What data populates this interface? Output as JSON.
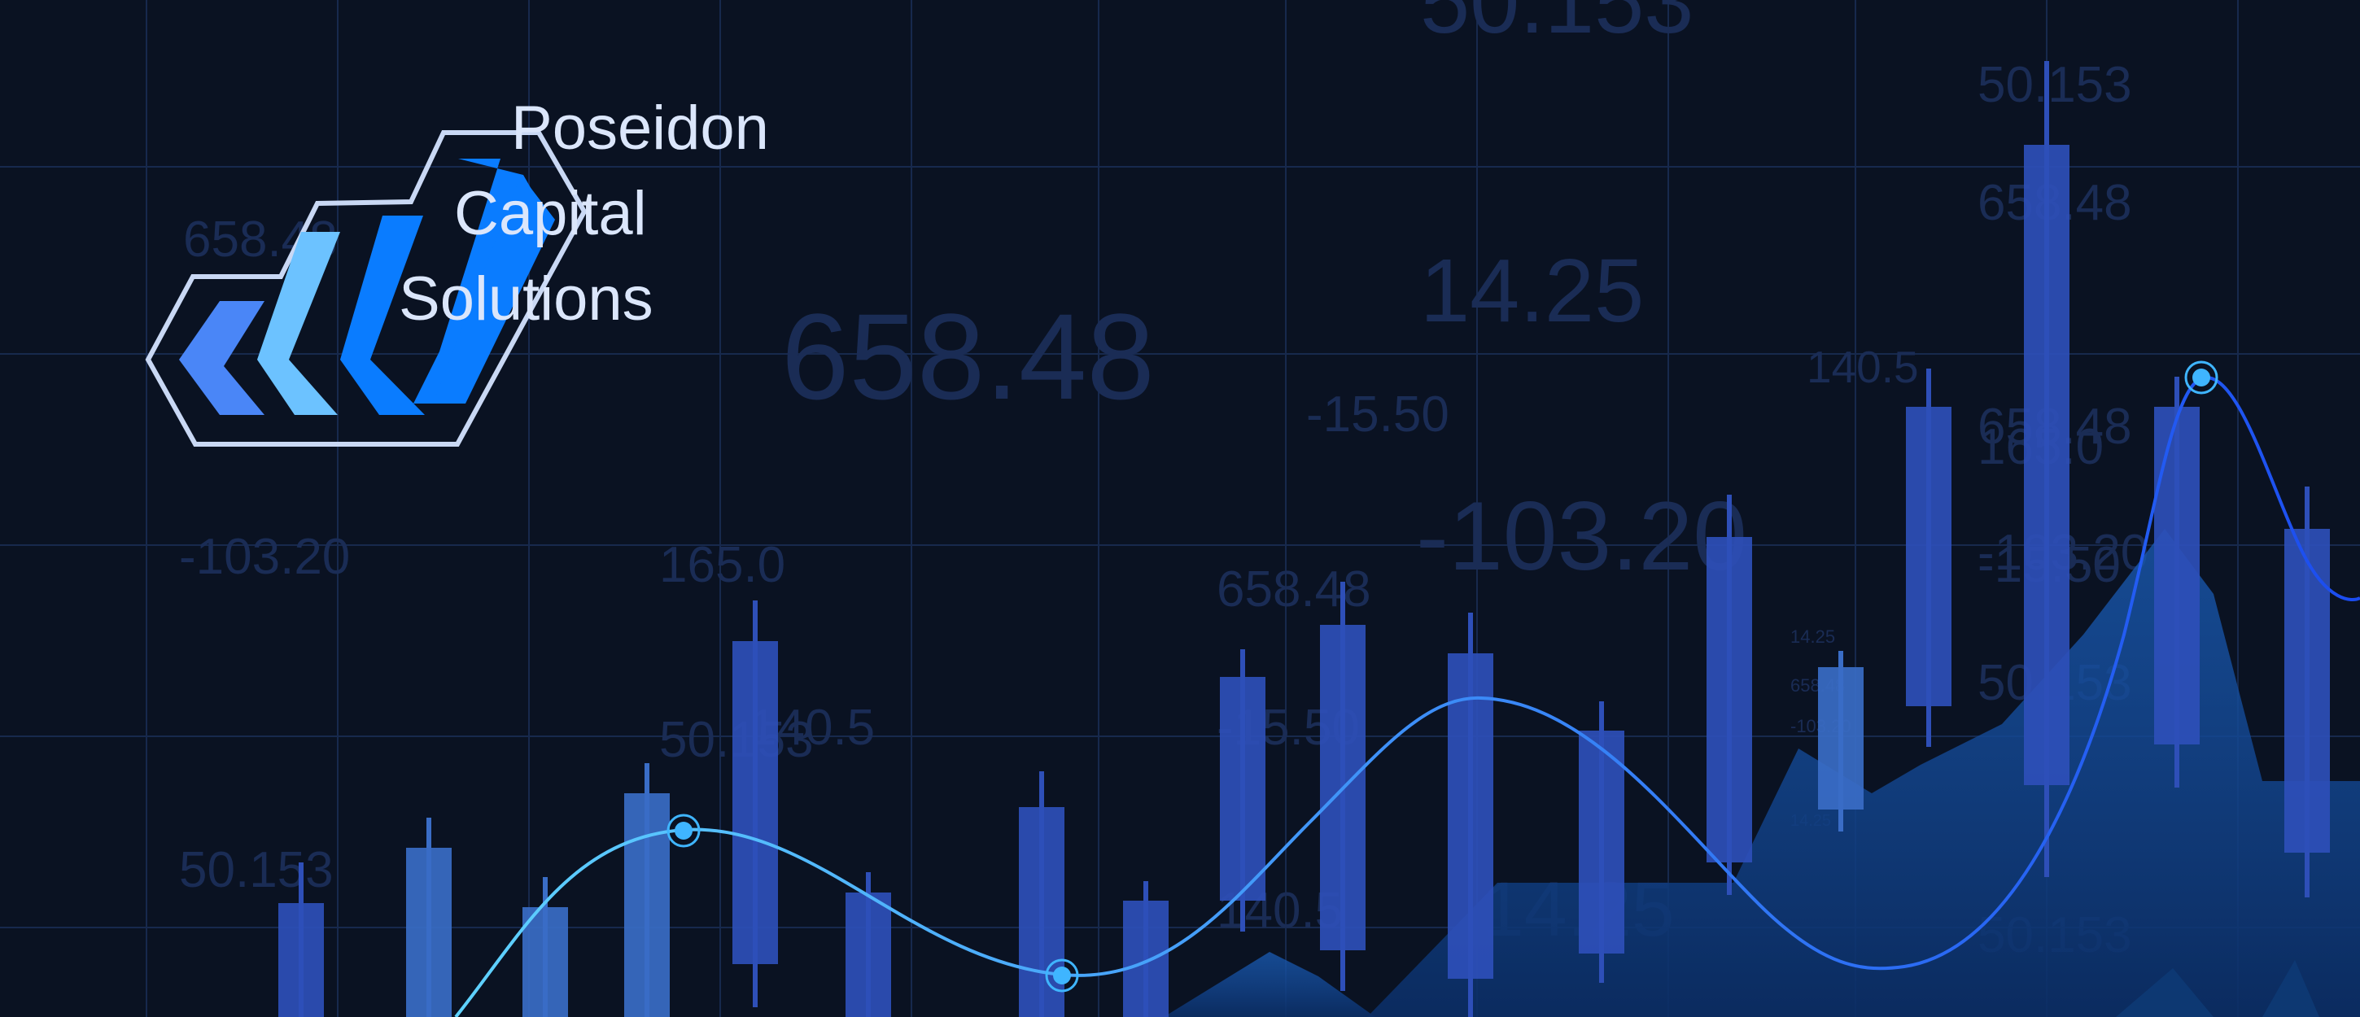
{
  "brand": {
    "line1": "Poseidon",
    "line2": "Capital",
    "line3": "Solutions",
    "colors": {
      "chevron_dark": "#4a86f7",
      "chevron_light": "#6cc2ff",
      "chevron_blue": "#0a7cff",
      "outline": "#c9d8f4"
    }
  },
  "background_numbers": [
    "50.153",
    "14.25",
    "658.48",
    "-15.50",
    "165.0",
    "140.5",
    "-103.20",
    "50.153",
    "658.48",
    "-15.50",
    "140.5",
    "-103.20",
    "14.25",
    "50.153",
    "658.48",
    "165.0",
    "-15.50",
    "140.5",
    "50.153",
    "14.25",
    "658.48",
    "-103.20",
    "50.153",
    "14.25",
    "658.48",
    "-103.20",
    "50.153",
    "658.48"
  ],
  "colors": {
    "background": "#0a1222",
    "grid": "#17294d",
    "candle": "#2e4fb8",
    "candle_light": "#3a66c4",
    "line_glow": "#39b8ff",
    "line": "#1d57f0",
    "area": "#0e3d7a",
    "marker": "#3fb5ff"
  }
}
